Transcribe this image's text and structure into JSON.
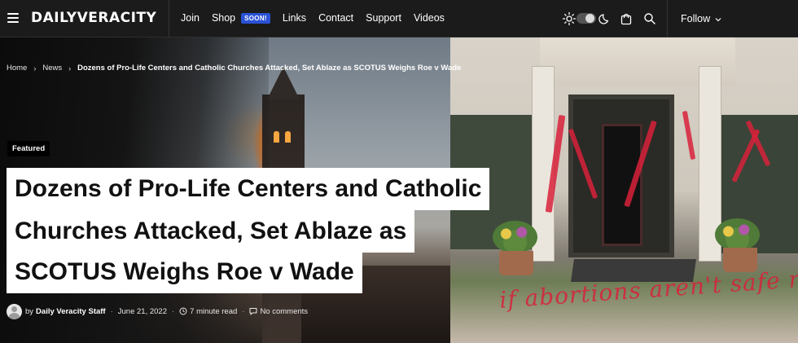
{
  "header": {
    "logo": "DAILYVERACITY",
    "nav": [
      {
        "label": "Join"
      },
      {
        "label": "Shop",
        "badge": "SOON!"
      },
      {
        "label": "Links"
      },
      {
        "label": "Contact"
      },
      {
        "label": "Support"
      },
      {
        "label": "Videos"
      }
    ],
    "follow_label": "Follow",
    "icons": [
      "menu-icon",
      "sun-icon",
      "theme-toggle",
      "moon-icon",
      "cart-icon",
      "search-icon",
      "chevron-down-icon"
    ],
    "badge_color": "#2a52d6"
  },
  "breadcrumb": {
    "items": [
      "Home",
      "News"
    ],
    "current": "Dozens of Pro-Life Centers and Catholic Churches Attacked, Set Ablaze as SCOTUS Weighs Roe v Wade"
  },
  "article": {
    "category_badge": "Featured",
    "title_lines": [
      "Dozens of Pro-Life Centers and Catholic",
      "Churches Attacked, Set Ablaze as",
      "SCOTUS Weighs Roe v Wade"
    ],
    "meta": {
      "by": "by",
      "author": "Daily Veracity Staff",
      "date": "June 21, 2022",
      "read_time": "7 minute read",
      "comments": "No comments"
    },
    "graffiti_text": "if abortions aren't safe neither are"
  }
}
